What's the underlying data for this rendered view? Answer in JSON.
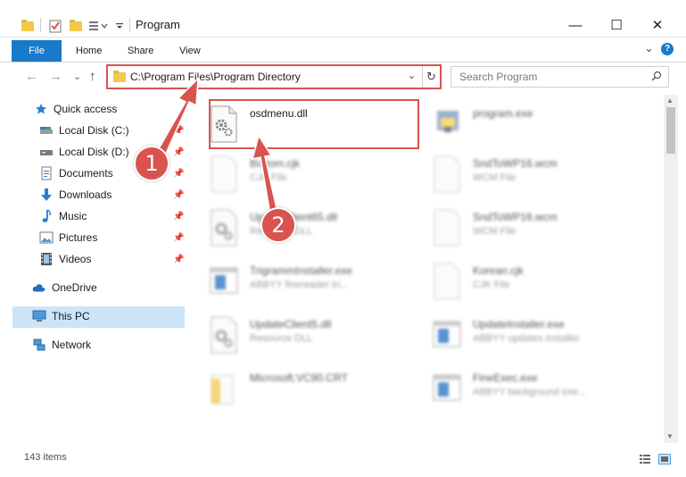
{
  "window": {
    "title": "Program",
    "minimize_glyph": "—",
    "maximize_glyph": "☐",
    "close_glyph": "✕"
  },
  "ribbon": {
    "tabs": [
      "File",
      "Home",
      "Share",
      "View"
    ],
    "expand_glyph": "⌄",
    "help_glyph": "?"
  },
  "nav": {
    "back_glyph": "←",
    "forward_glyph": "→",
    "recent_glyph": "⌄",
    "up_glyph": "↑"
  },
  "address": {
    "path": "C:\\Program Files\\Program Directory",
    "chevron": "⌄",
    "refresh_glyph": "↻"
  },
  "search": {
    "placeholder": "Search Program"
  },
  "sidebar": {
    "items": [
      {
        "label": "Quick access",
        "icon": "star-icon"
      },
      {
        "label": "Local Disk (C:)",
        "icon": "drive-icon",
        "pinned": true
      },
      {
        "label": "Local Disk (D:)",
        "icon": "drive-icon",
        "pinned": true
      },
      {
        "label": "Documents",
        "icon": "documents-icon",
        "pinned": true
      },
      {
        "label": "Downloads",
        "icon": "download-icon",
        "pinned": true
      },
      {
        "label": "Music",
        "icon": "music-icon",
        "pinned": true
      },
      {
        "label": "Pictures",
        "icon": "pictures-icon",
        "pinned": true
      },
      {
        "label": "Videos",
        "icon": "videos-icon",
        "pinned": true
      },
      {
        "label": "OneDrive",
        "icon": "cloud-icon"
      },
      {
        "label": "This PC",
        "icon": "computer-icon",
        "selected": true
      },
      {
        "label": "Network",
        "icon": "network-icon"
      }
    ],
    "pin_glyph": "📌"
  },
  "files": [
    {
      "name": "osdmenu.dll",
      "desc": "",
      "icon": "dll-gear-icon",
      "highlighted": true
    },
    {
      "name": "program.exe",
      "desc": "",
      "icon": "exe-app-icon"
    },
    {
      "name": "Bottom.cjk",
      "desc": "CJK File",
      "icon": "blank-file-icon"
    },
    {
      "name": "SndToWP16.wcm",
      "desc": "WCM File",
      "icon": "blank-file-icon"
    },
    {
      "name": "UpdateClient65.dll",
      "desc": "Resource DLL",
      "icon": "dll-gear-icon"
    },
    {
      "name": "SndToWP16.wcm",
      "desc": "WCM File",
      "icon": "blank-file-icon"
    },
    {
      "name": "TrigrammInstaller.exe",
      "desc": "ABBYY finereader tri...",
      "icon": "exe-window-icon"
    },
    {
      "name": "Korean.cjk",
      "desc": "CJK File",
      "icon": "blank-file-icon"
    },
    {
      "name": "UpdateClient5.dll",
      "desc": "Resource DLL",
      "icon": "dll-gear-icon"
    },
    {
      "name": "UpdateInstaller.exe",
      "desc": "ABBYY updates installer",
      "icon": "exe-window-icon"
    },
    {
      "name": "Microsoft.VC90.CRT",
      "desc": "",
      "icon": "folder-icon"
    },
    {
      "name": "FineExec.exe",
      "desc": "ABBYY background exe...",
      "icon": "exe-window-icon"
    }
  ],
  "status": {
    "item_count": "143 items"
  },
  "annotations": {
    "badge1": "1",
    "badge2": "2",
    "color": "#d9534f"
  },
  "colors": {
    "accent": "#1979ca",
    "selection": "#cce4f7",
    "folder": "#f2c94c"
  }
}
